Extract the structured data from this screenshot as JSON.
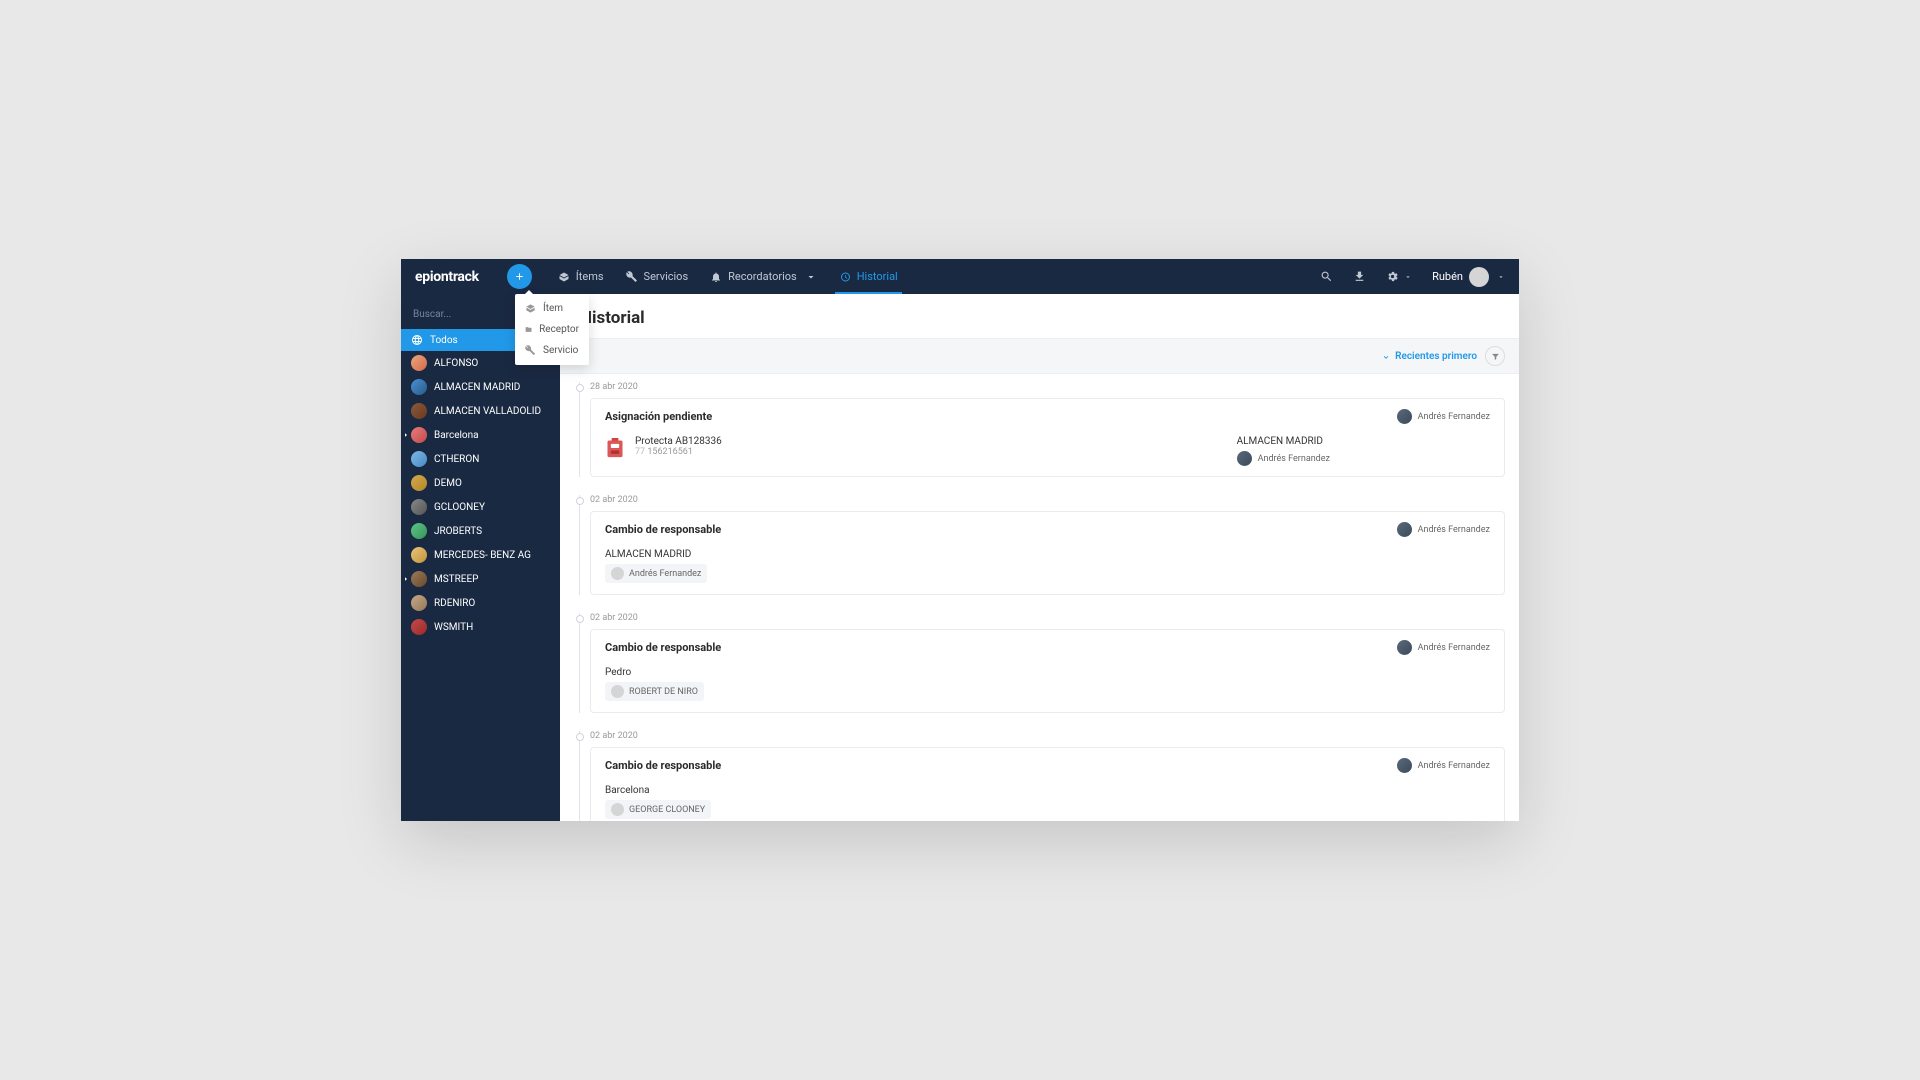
{
  "brand": "epiontrack",
  "nav": {
    "items": "Ítems",
    "services": "Servicios",
    "reminders": "Recordatorios",
    "history": "Historial"
  },
  "user": {
    "name": "Rubén"
  },
  "add_menu": {
    "item": "Ítem",
    "receiver": "Receptor",
    "service": "Servicio"
  },
  "sidebar": {
    "search_placeholder": "Buscar...",
    "all": "Todos",
    "entries": [
      {
        "label": "ALFONSO"
      },
      {
        "label": "ALMACEN MADRID"
      },
      {
        "label": "ALMACEN VALLADOLID"
      },
      {
        "label": "Barcelona",
        "expandable": true
      },
      {
        "label": "CTHERON"
      },
      {
        "label": "DEMO"
      },
      {
        "label": "GCLOONEY"
      },
      {
        "label": "JROBERTS"
      },
      {
        "label": "MERCEDES- BENZ AG"
      },
      {
        "label": "MSTREEP",
        "expandable": true
      },
      {
        "label": "RDENIRO"
      },
      {
        "label": "WSMITH"
      }
    ]
  },
  "page": {
    "title": "Historial",
    "sort": "Recientes primero"
  },
  "timeline": [
    {
      "date": "28 abr 2020",
      "cards": [
        {
          "title": "Asignación pendiente",
          "author": "Andrés Fernandez",
          "item": {
            "name": "Protecta AB128336",
            "code_pref": "77",
            "code": "156216561"
          },
          "assign": {
            "location": "ALMACEN MADRID",
            "user": "Andrés Fernandez"
          }
        }
      ]
    },
    {
      "date": "02 abr 2020",
      "cards": [
        {
          "title": "Cambio de responsable",
          "author": "Andrés Fernandez",
          "location": "ALMACEN MADRID",
          "chip_user": "Andrés Fernandez"
        }
      ]
    },
    {
      "date": "02 abr 2020",
      "cards": [
        {
          "title": "Cambio de responsable",
          "author": "Andrés Fernandez",
          "location": "Pedro",
          "chip_user": "ROBERT DE NIRO"
        }
      ]
    },
    {
      "date": "02 abr 2020",
      "cards": [
        {
          "title": "Cambio de responsable",
          "author": "Andrés Fernandez",
          "location": "Barcelona",
          "chip_user": "GEORGE CLOONEY"
        }
      ]
    }
  ]
}
